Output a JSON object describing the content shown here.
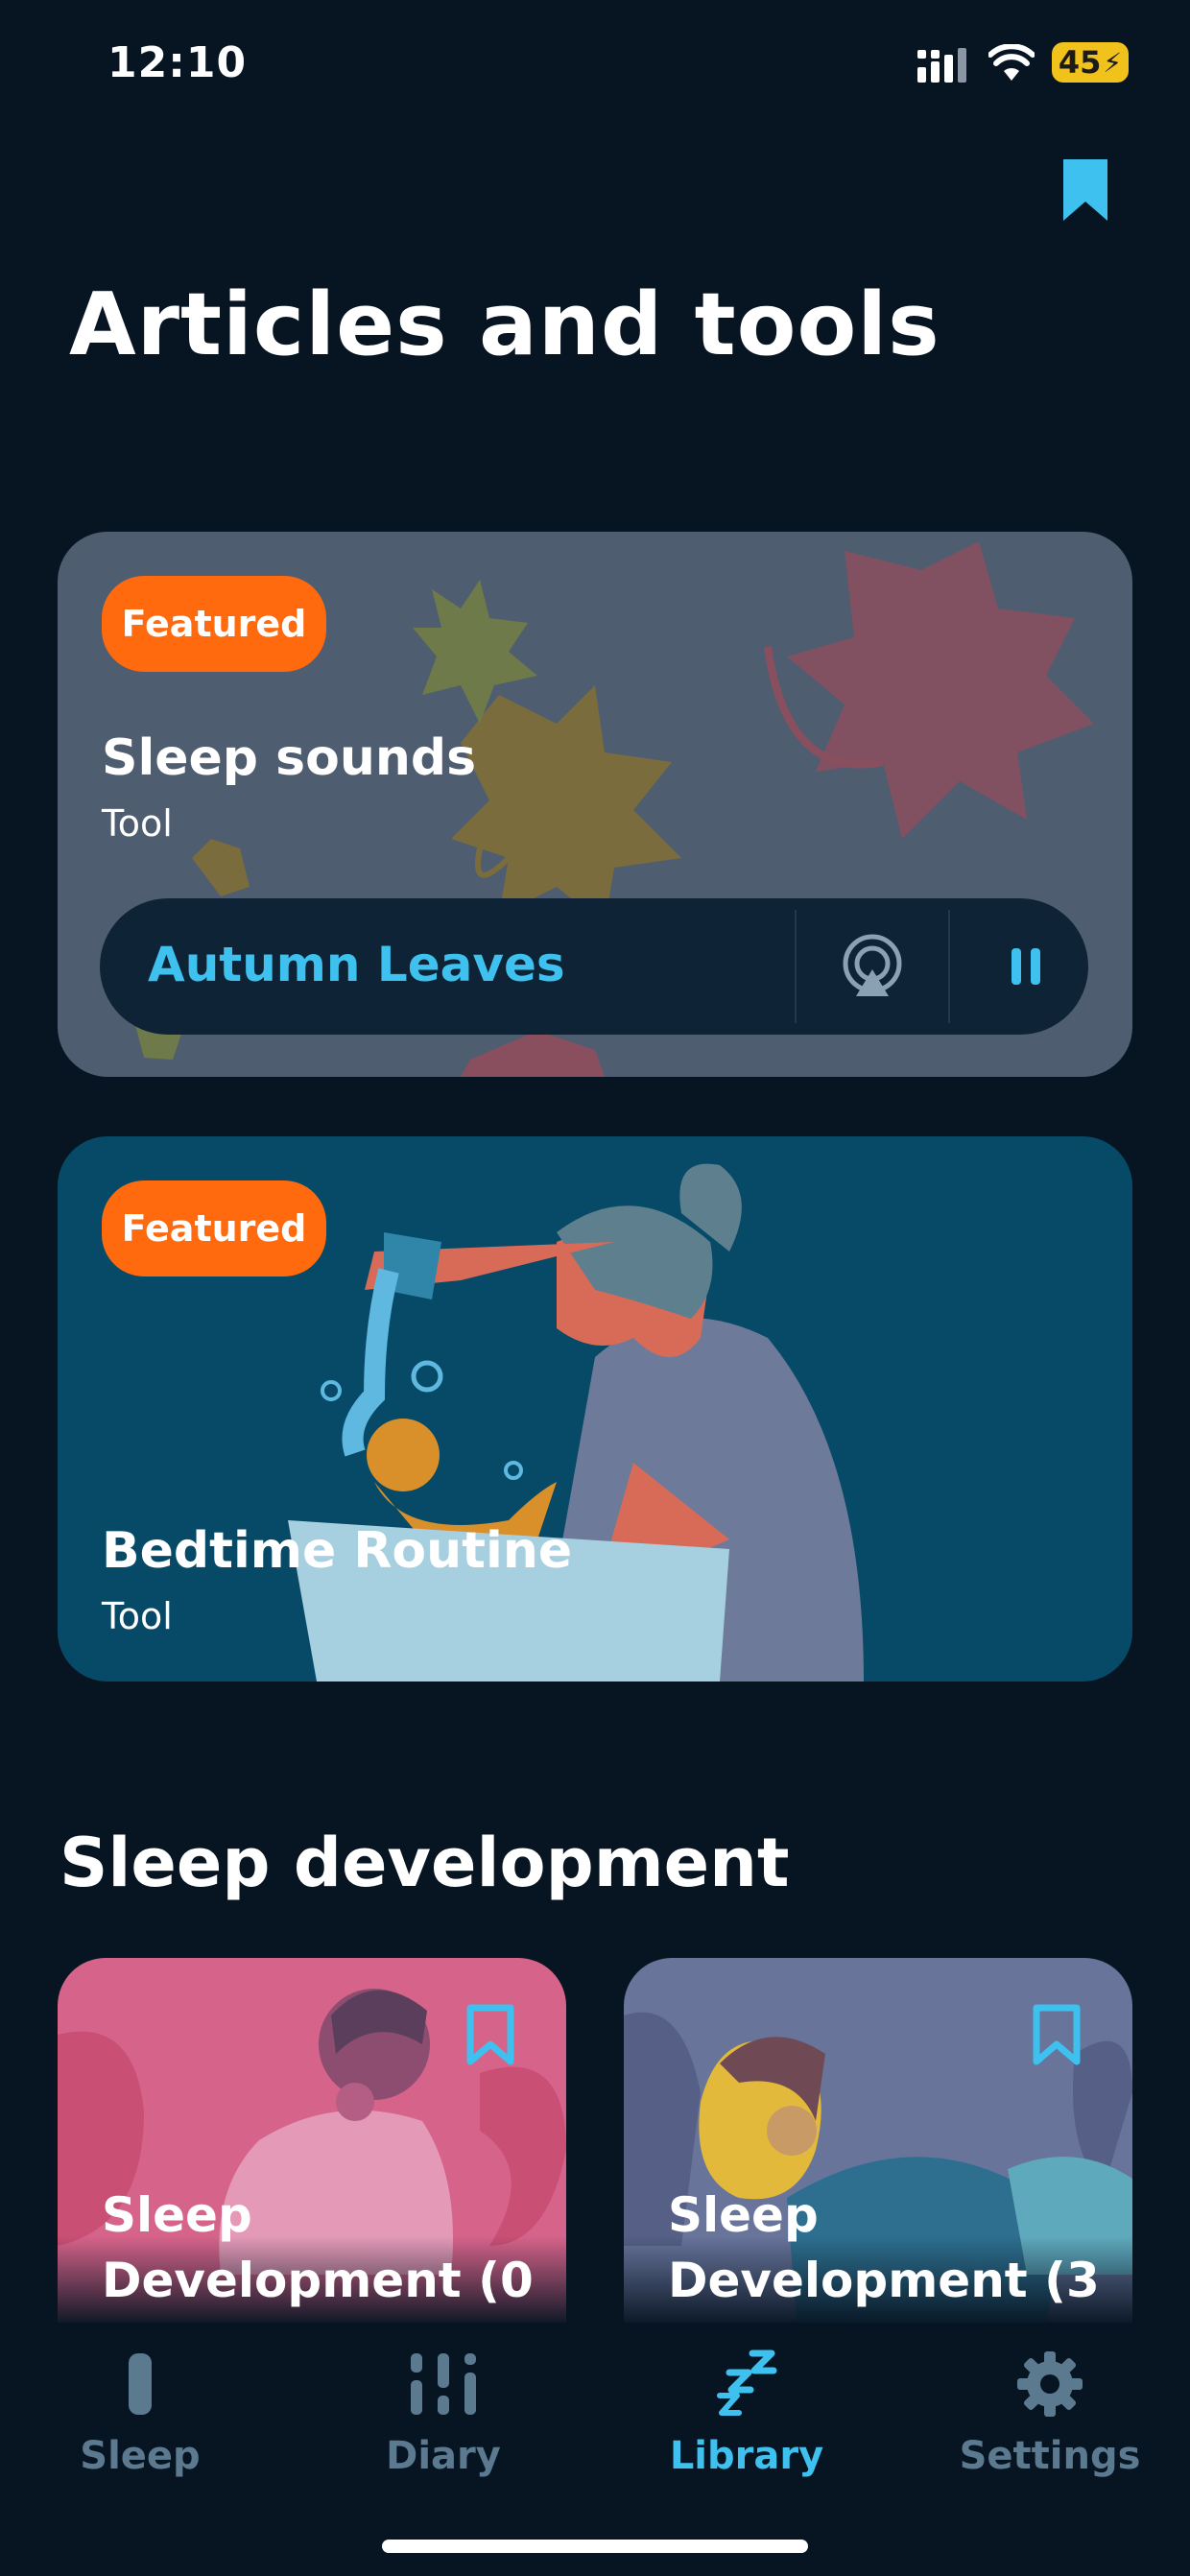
{
  "status": {
    "time": "12:10",
    "battery": "45"
  },
  "header": {
    "title": "Articles and tools"
  },
  "featured_cards": [
    {
      "badge": "Featured",
      "title": "Sleep sounds",
      "type": "Tool",
      "player": {
        "track": "Autumn Leaves"
      }
    },
    {
      "badge": "Featured",
      "title": "Bedtime Routine",
      "type": "Tool"
    }
  ],
  "sleep_development": {
    "title": "Sleep development",
    "items": [
      {
        "title": "Sleep Development (0"
      },
      {
        "title": "Sleep Development (3"
      }
    ]
  },
  "tabs": [
    {
      "label": "Sleep",
      "active": false
    },
    {
      "label": "Diary",
      "active": false
    },
    {
      "label": "Library",
      "active": true
    },
    {
      "label": "Settings",
      "active": false
    }
  ],
  "colors": {
    "accent": "#3ec1ee",
    "badge": "#ff6a0e",
    "background": "#071522"
  }
}
